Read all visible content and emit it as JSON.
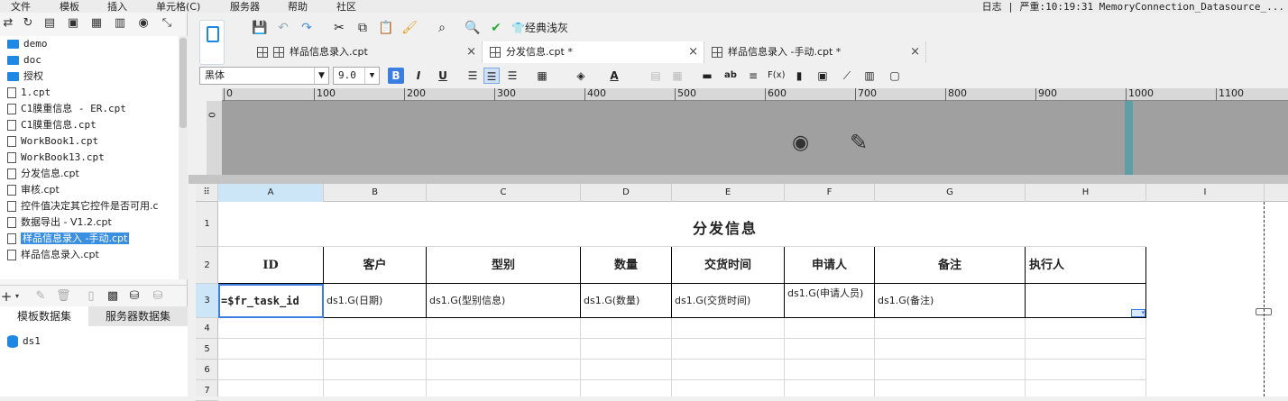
{
  "menu": [
    "文件",
    "模板",
    "插入",
    "单元格(C)",
    "服务器",
    "帮助",
    "社区"
  ],
  "log_line": "日志 | 严重:10:19:31 MemoryConnection_Datasource_...",
  "tree": {
    "items": [
      {
        "label": "demo",
        "kind": "folder"
      },
      {
        "label": "doc",
        "kind": "folder"
      },
      {
        "label": "授权",
        "kind": "folder"
      },
      {
        "label": "1.cpt",
        "kind": "file"
      },
      {
        "label": "C1膜重信息 - ER.cpt",
        "kind": "file"
      },
      {
        "label": "C1膜重信息.cpt",
        "kind": "file"
      },
      {
        "label": "WorkBook1.cpt",
        "kind": "file"
      },
      {
        "label": "WorkBook13.cpt",
        "kind": "file"
      },
      {
        "label": "分发信息.cpt",
        "kind": "file"
      },
      {
        "label": "审核.cpt",
        "kind": "file"
      },
      {
        "label": "控件值决定其它控件是否可用.c",
        "kind": "file"
      },
      {
        "label": "数据导出 - V1.2.cpt",
        "kind": "file"
      },
      {
        "label": "样品信息录入 -手动.cpt",
        "kind": "file",
        "selected": true
      },
      {
        "label": "样品信息录入.cpt",
        "kind": "file"
      }
    ]
  },
  "dataset_tabs": [
    "模板数据集",
    "服务器数据集"
  ],
  "datasets": [
    "ds1"
  ],
  "toolbar": {
    "theme_label": "经典浅灰"
  },
  "tabs": [
    {
      "label": "样品信息录入.cpt",
      "close": "×"
    },
    {
      "label": "分发信息.cpt *",
      "close": "×",
      "active": true
    },
    {
      "label": "样品信息录入 -手动.cpt *",
      "close": "×"
    }
  ],
  "format": {
    "font": "黑体",
    "size": "9.0",
    "bold": "B",
    "italic": "I",
    "underline": "U"
  },
  "ruler": [
    "0",
    "100",
    "200",
    "300",
    "400",
    "500",
    "600",
    "700",
    "800",
    "900",
    "1000",
    "1100"
  ],
  "vruler": "0",
  "columns": [
    "A",
    "B",
    "C",
    "D",
    "E",
    "F",
    "G",
    "H",
    "I"
  ],
  "rows": [
    "1",
    "2",
    "3",
    "4",
    "5",
    "6",
    "7"
  ],
  "sheet": {
    "title": "分发信息",
    "headers": [
      "ID",
      "客户",
      "型别",
      "数量",
      "交货时间",
      "申请人",
      "备注",
      "执行人"
    ],
    "row3": [
      "=$fr_task_id",
      "ds1.G(日期)",
      "ds1.G(型别信息)",
      "ds1.G(数量)",
      "ds1.G(交货时间)",
      "ds1.G(申请人员)",
      "ds1.G(备注)",
      ""
    ]
  },
  "colors": {
    "accent": "#3b8fe0",
    "selection_header": "#cde6f7",
    "header_band": "#5f9ea6"
  }
}
